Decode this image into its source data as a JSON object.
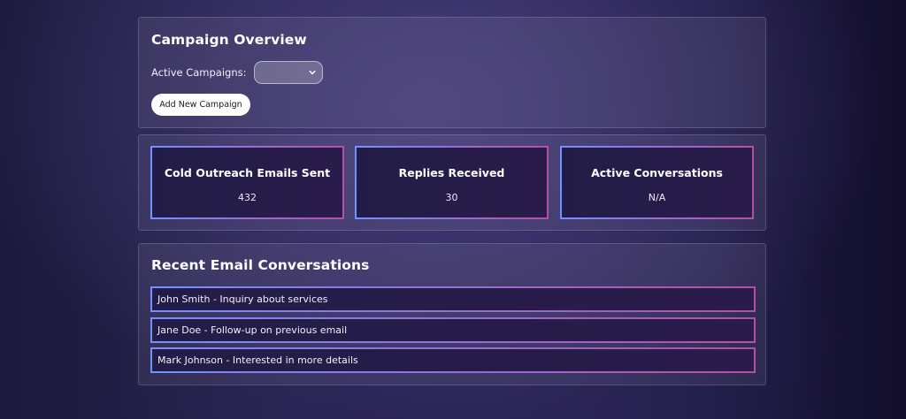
{
  "overview": {
    "title": "Campaign Overview",
    "active_campaigns_label": "Active Campaigns:",
    "active_campaigns_value": "",
    "add_button_label": "Add New Campaign"
  },
  "stats": [
    {
      "title": "Cold Outreach Emails Sent",
      "value": "432"
    },
    {
      "title": "Replies Received",
      "value": "30"
    },
    {
      "title": "Active Conversations",
      "value": "N/A"
    }
  ],
  "recent": {
    "title": "Recent Email Conversations",
    "conversations": [
      "John Smith - Inquiry about services",
      "Jane Doe - Follow-up on previous email",
      "Mark Johnson - Interested in more details"
    ]
  },
  "colors": {
    "card_border_start": "#7590ff",
    "card_border_end": "#b54fa6",
    "button_bg": "#ffffff"
  },
  "icons": {
    "select_chevron": "chevron-down-icon"
  }
}
